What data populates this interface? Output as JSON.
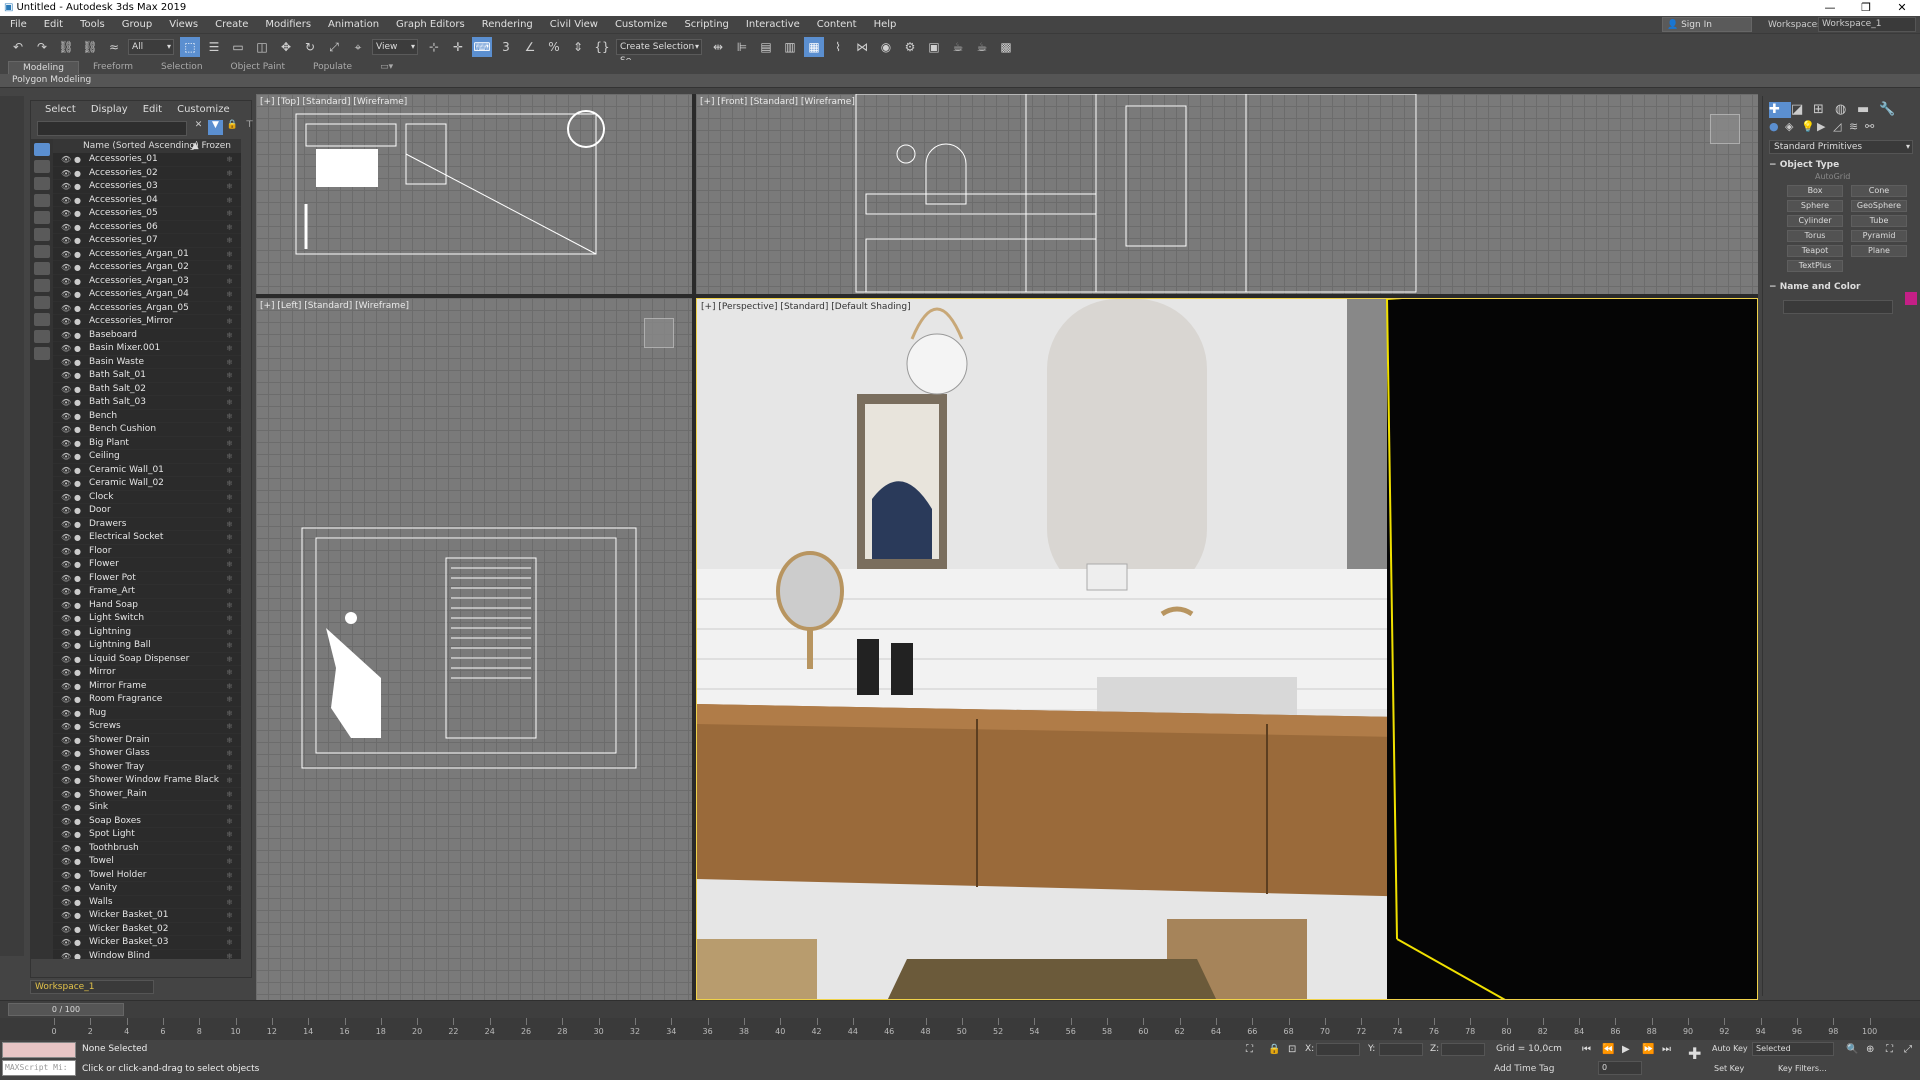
{
  "window": {
    "title": "Untitled - Autodesk 3ds Max 2019",
    "minimize": "—",
    "maximize": "❐",
    "close": "✕"
  },
  "menu": [
    "File",
    "Edit",
    "Tools",
    "Group",
    "Views",
    "Create",
    "Modifiers",
    "Animation",
    "Graph Editors",
    "Rendering",
    "Civil View",
    "Customize",
    "Scripting",
    "Interactive",
    "Content",
    "Help"
  ],
  "account": {
    "signin": "Sign In",
    "workspaces_label": "Workspaces:",
    "workspace": "Workspace_1"
  },
  "toolbar": {
    "filter": "All",
    "refcoord": "View",
    "selset": "Create Selection Se"
  },
  "ribbon": {
    "tabs": [
      "Modeling",
      "Freeform",
      "Selection",
      "Object Paint",
      "Populate"
    ],
    "active": "Modeling",
    "subtitle": "Polygon Modeling"
  },
  "scene": {
    "tabs": [
      "Select",
      "Display",
      "Edit",
      "Customize"
    ],
    "header": "Name (Sorted Ascending)",
    "frozen": "▲ Frozen",
    "items": [
      "Accessories_01",
      "Accessories_02",
      "Accessories_03",
      "Accessories_04",
      "Accessories_05",
      "Accessories_06",
      "Accessories_07",
      "Accessories_Argan_01",
      "Accessories_Argan_02",
      "Accessories_Argan_03",
      "Accessories_Argan_04",
      "Accessories_Argan_05",
      "Accessories_Mirror",
      "Baseboard",
      "Basin Mixer.001",
      "Basin Waste",
      "Bath Salt_01",
      "Bath Salt_02",
      "Bath Salt_03",
      "Bench",
      "Bench Cushion",
      "Big Plant",
      "Ceiling",
      "Ceramic Wall_01",
      "Ceramic Wall_02",
      "Clock",
      "Door",
      "Drawers",
      "Electrical Socket",
      "Floor",
      "Flower",
      "Flower Pot",
      "Frame_Art",
      "Hand Soap",
      "Light Switch",
      "Lightning",
      "Lightning Ball",
      "Liquid Soap Dispenser",
      "Mirror",
      "Mirror Frame",
      "Room Fragrance",
      "Rug",
      "Screws",
      "Shower Drain",
      "Shower Glass",
      "Shower Tray",
      "Shower Window Frame Black",
      "Shower_Rain",
      "Sink",
      "Soap Boxes",
      "Spot Light",
      "Toothbrush",
      "Towel",
      "Towel Holder",
      "Vanity",
      "Walls",
      "Wicker Basket_01",
      "Wicker Basket_02",
      "Wicker Basket_03",
      "Window Blind"
    ],
    "workspace": "Workspace_1"
  },
  "viewports": {
    "top": "[+] [Top] [Standard] [Wireframe]",
    "front": "[+] [Front] [Standard] [Wireframe]",
    "left": "[+] [Left] [Standard] [Wireframe]",
    "persp": "[+] [Perspective] [Standard] [Default Shading]"
  },
  "command": {
    "category": "Standard Primitives",
    "object_type": "Object Type",
    "autogrid": "AutoGrid",
    "primitives": [
      "Box",
      "Cone",
      "Sphere",
      "GeoSphere",
      "Cylinder",
      "Tube",
      "Torus",
      "Pyramid",
      "Teapot",
      "Plane",
      "TextPlus"
    ],
    "name_color": "Name and Color",
    "color": "#c41f86"
  },
  "timeline": {
    "slider": "0 / 100",
    "ticks": [
      "0",
      "2",
      "4",
      "6",
      "8",
      "10",
      "12",
      "14",
      "16",
      "18",
      "20",
      "22",
      "24",
      "26",
      "28",
      "30",
      "32",
      "34",
      "36",
      "38",
      "40",
      "42",
      "44",
      "46",
      "48",
      "50",
      "52",
      "54",
      "56",
      "58",
      "60",
      "62",
      "64",
      "66",
      "68",
      "70",
      "72",
      "74",
      "76",
      "78",
      "80",
      "82",
      "84",
      "86",
      "88",
      "90",
      "92",
      "94",
      "96",
      "98",
      "100"
    ]
  },
  "status": {
    "maxscript": "MAXScript Mi:",
    "selection": "None Selected",
    "hint": "Click or click-and-drag to select objects",
    "x_label": "X:",
    "y_label": "Y:",
    "z_label": "Z:",
    "grid": "Grid = 10,0cm",
    "add_time_tag": "Add Time Tag",
    "auto_key": "Auto Key",
    "selected": "Selected",
    "set_key": "Set Key",
    "key_filters": "Key Filters...",
    "frame": "0"
  }
}
